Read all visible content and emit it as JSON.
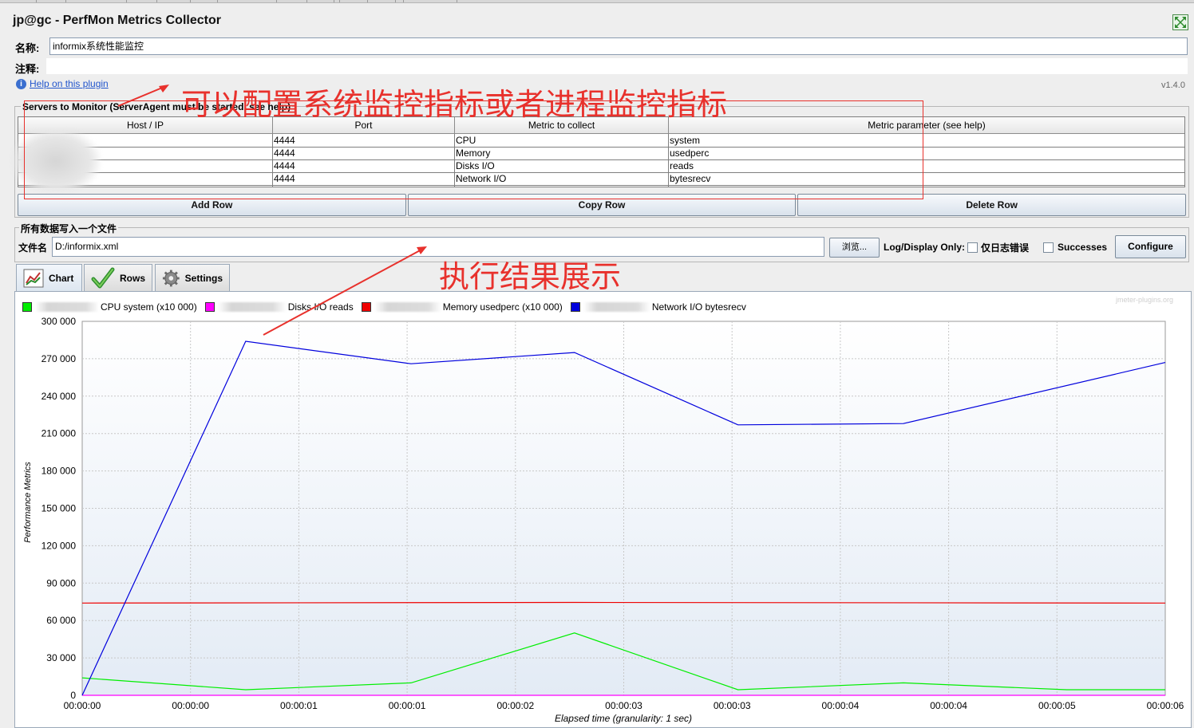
{
  "header": {
    "title": "jp@gc - PerfMon Metrics Collector",
    "name_label": "名称:",
    "name_value": "informix系统性能监控",
    "comment_label": "注释:",
    "comment_value": "",
    "help_link": "Help on this plugin",
    "version": "v1.4.0"
  },
  "servers": {
    "title": "Servers to Monitor (ServerAgent must be started, see help)",
    "columns": [
      "Host / IP",
      "Port",
      "Metric to collect",
      "Metric parameter (see help)"
    ],
    "rows": [
      {
        "host": "",
        "port": "4444",
        "metric": "CPU",
        "param": "system"
      },
      {
        "host": "",
        "port": "4444",
        "metric": "Memory",
        "param": "usedperc"
      },
      {
        "host": "",
        "port": "4444",
        "metric": "Disks I/O",
        "param": "reads"
      },
      {
        "host": "",
        "port": "4444",
        "metric": "Network I/O",
        "param": "bytesrecv"
      }
    ],
    "buttons": {
      "add": "Add Row",
      "copy": "Copy Row",
      "delete": "Delete Row"
    }
  },
  "file_section": {
    "title": "所有数据写入一个文件",
    "file_label": "文件名",
    "file_value": "D:/informix.xml",
    "browse_label": "浏览...",
    "log_display_label": "Log/Display Only:",
    "errors_only_label": "仅日志错误",
    "successes_label": "Successes",
    "configure_label": "Configure"
  },
  "tabs": [
    {
      "label": "Chart",
      "icon": "chart-icon",
      "active": true
    },
    {
      "label": "Rows",
      "icon": "checkmark-icon",
      "active": false
    },
    {
      "label": "Settings",
      "icon": "gear-icon",
      "active": false
    }
  ],
  "annotations": {
    "top": "可以配置系统监控指标或者进程监控指标",
    "bottom": "执行结果展示"
  },
  "watermark": "jmeter-plugins.org",
  "colors": {
    "accent": "#3b6fcf",
    "annotation": "#e8312c"
  },
  "chart_data": {
    "type": "line",
    "xlabel": "Elapsed time (granularity: 1 sec)",
    "ylabel": "Performance Metrics",
    "ylim": [
      0,
      300000
    ],
    "yticks": [
      "0",
      "30 000",
      "60 000",
      "90 000",
      "120 000",
      "150 000",
      "180 000",
      "210 000",
      "240 000",
      "270 000",
      "300 000"
    ],
    "xticks": [
      "00:00:00",
      "00:00:00",
      "00:00:01",
      "00:00:01",
      "00:00:02",
      "00:00:03",
      "00:00:03",
      "00:00:04",
      "00:00:04",
      "00:00:05",
      "00:00:06"
    ],
    "x_range_seconds": [
      0,
      5.5
    ],
    "grid": true,
    "legend_position": "top-left",
    "series": [
      {
        "name": "CPU system (x10 000)",
        "color": "#00ee00",
        "x": [
          0,
          0.83,
          1.67,
          2.5,
          3.33,
          4.17,
          5.0,
          5.5
        ],
        "values": [
          14000,
          4500,
          10000,
          50000,
          4500,
          10000,
          4500,
          4500
        ]
      },
      {
        "name": "Disks I/O reads",
        "color": "#ff00ff",
        "x": [
          0,
          5.5
        ],
        "values": [
          0,
          0
        ]
      },
      {
        "name": "Memory usedperc (x10 000)",
        "color": "#ee0000",
        "x": [
          0,
          2.5,
          5.5
        ],
        "values": [
          74000,
          74500,
          74000
        ]
      },
      {
        "name": "Network I/O bytesrecv",
        "color": "#0000dd",
        "x": [
          0,
          0.83,
          1.67,
          2.5,
          3.33,
          4.17,
          5.5
        ],
        "values": [
          0,
          284000,
          266000,
          275000,
          217000,
          218000,
          267000
        ]
      }
    ]
  }
}
